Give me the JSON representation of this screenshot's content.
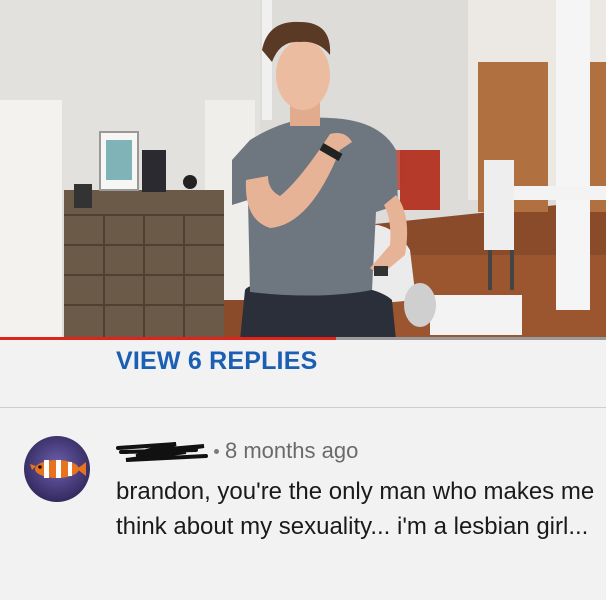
{
  "video": {
    "progress_fraction": 0.555
  },
  "replies": {
    "label": "VIEW 6 REPLIES"
  },
  "comment": {
    "author_redacted": true,
    "timestamp": "8 months ago",
    "text": "brandon, you're the only man who makes me think about my sexuality... i'm a lesbian girl...",
    "avatar_icon": "clownfish-icon"
  },
  "colors": {
    "accent_link": "#1a5fb4",
    "progress": "#e0241b",
    "background": "#f2f2f2"
  }
}
